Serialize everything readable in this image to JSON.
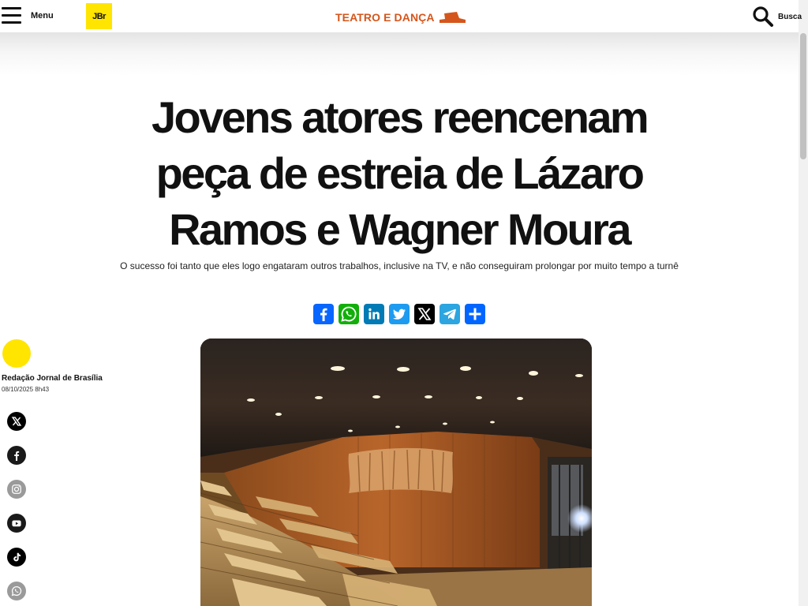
{
  "header": {
    "menu_label": "Menu",
    "logo_text": "JBr",
    "section_label": "TEATRO E DANÇA",
    "search_label": "Busca"
  },
  "article": {
    "headline": "Jovens atores reencenam peça de estreia de Lázaro Ramos e Wagner Moura",
    "subtitle": "O sucesso foi tanto que eles logo engataram outros trabalhos, inclusive na TV, e não conseguiram prolongar por muito tempo a turnê"
  },
  "share_buttons": [
    {
      "name": "Facebook",
      "icon": "facebook-icon",
      "color": "#0866ff"
    },
    {
      "name": "WhatsApp",
      "icon": "whatsapp-icon",
      "color": "#12af0a"
    },
    {
      "name": "LinkedIn",
      "icon": "linkedin-icon",
      "color": "#007bb5"
    },
    {
      "name": "Twitter",
      "icon": "twitter-icon",
      "color": "#1d9bf0"
    },
    {
      "name": "X",
      "icon": "x-icon",
      "color": "#000000"
    },
    {
      "name": "Telegram",
      "icon": "telegram-icon",
      "color": "#2ca5e0"
    },
    {
      "name": "Share",
      "icon": "share-icon",
      "color": "#0166ff"
    }
  ],
  "author": {
    "name": "Redação Jornal de Brasília",
    "date": "08/10/2025 8h43"
  },
  "social_links": [
    {
      "icon": "x-icon",
      "color": "#000000"
    },
    {
      "icon": "facebook-icon",
      "color": "#111111"
    },
    {
      "icon": "instagram-icon",
      "color": "#9a9a9a"
    },
    {
      "icon": "youtube-icon",
      "color": "#111111"
    },
    {
      "icon": "tiktok-icon",
      "color": "#000000"
    },
    {
      "icon": "whatsapp-icon",
      "color": "#9a9a9a"
    }
  ],
  "colors": {
    "brand_yellow": "#ffe500",
    "section_orange": "#d4561c"
  }
}
